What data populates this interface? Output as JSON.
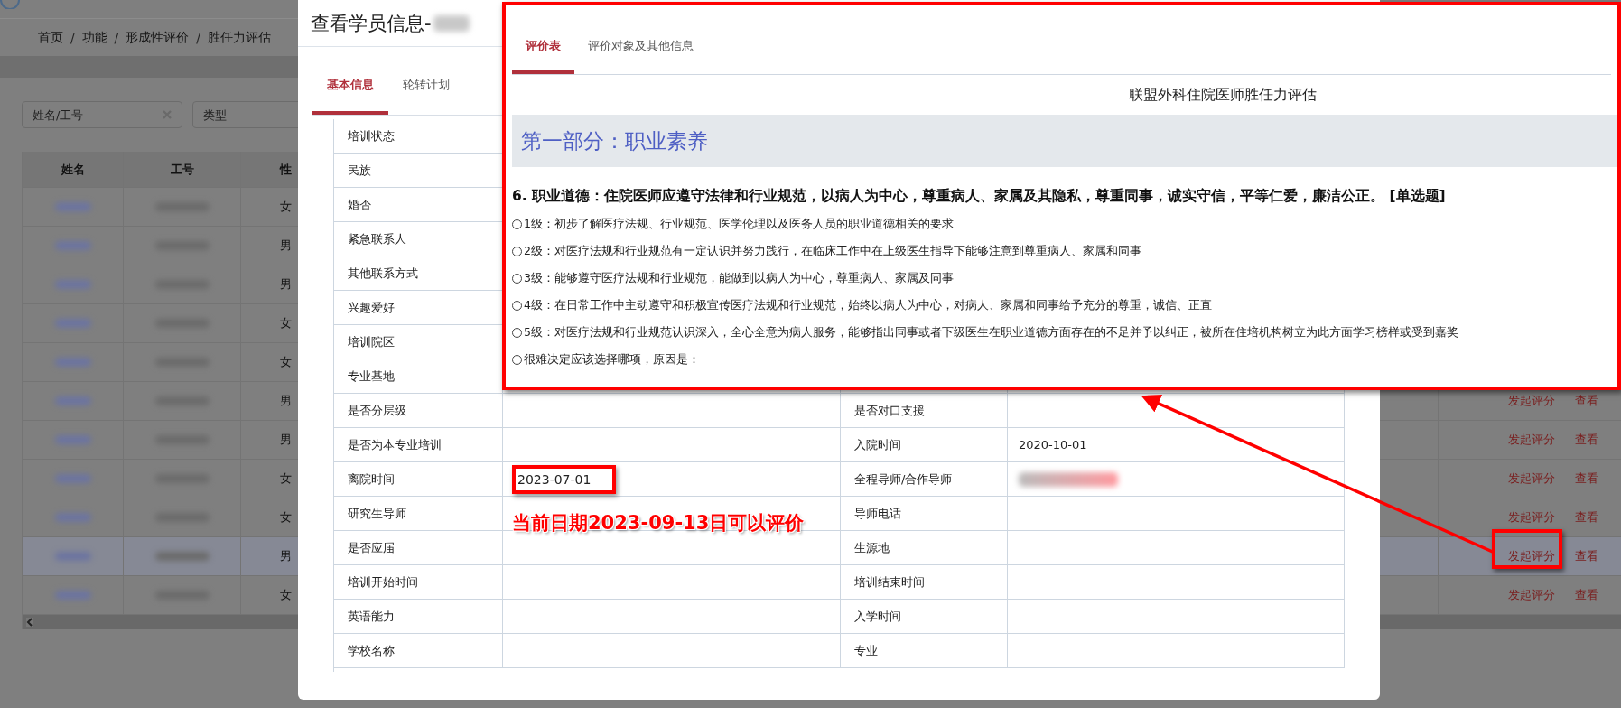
{
  "breadcrumb": {
    "separator": "/",
    "items": [
      "首页",
      "功能",
      "形成性评价",
      "胜任力评估"
    ]
  },
  "filters": [
    {
      "placeholder": "姓名/工号",
      "clearable": true
    },
    {
      "placeholder": "类型",
      "clearable": false
    }
  ],
  "background_table": {
    "columns": [
      "姓名",
      "工号",
      "性"
    ],
    "rows": [
      {
        "gender": "女",
        "selected": false
      },
      {
        "gender": "男",
        "selected": false
      },
      {
        "gender": "男",
        "selected": false
      },
      {
        "gender": "女",
        "selected": false
      },
      {
        "gender": "女",
        "selected": false
      },
      {
        "gender": "男",
        "selected": false,
        "actions": [
          "发起评分",
          "查看"
        ]
      },
      {
        "gender": "男",
        "selected": false,
        "actions": [
          "发起评分",
          "查看"
        ]
      },
      {
        "gender": "女",
        "selected": false,
        "actions": [
          "发起评分",
          "查看"
        ]
      },
      {
        "gender": "女",
        "selected": false,
        "actions": [
          "发起评分",
          "查看"
        ]
      },
      {
        "gender": "男",
        "selected": true,
        "actions": [
          "发起评分",
          "查看"
        ]
      },
      {
        "gender": "女",
        "selected": false,
        "actions": [
          "发起评分",
          "查看"
        ]
      }
    ]
  },
  "modal": {
    "title": "查看学员信息-",
    "name_blurred": true,
    "tabs": [
      {
        "label": "基本信息",
        "selected": true
      },
      {
        "label": "轮转计划",
        "selected": false
      }
    ],
    "info_rows": [
      {
        "label": "培训状态"
      },
      {
        "label": "民族"
      },
      {
        "label": "婚否"
      },
      {
        "label": "紧急联系人"
      },
      {
        "label": "其他联系方式"
      },
      {
        "label": "兴趣爱好"
      },
      {
        "label": "培训院区"
      },
      {
        "label": "专业基地"
      },
      {
        "label": "是否分层级",
        "label2": "是否对口支援"
      },
      {
        "label": "是否为本专业培训",
        "label2": "入院时间",
        "value2": "2020-10-01"
      },
      {
        "label": "离院时间",
        "value": "2023-07-01",
        "value_highlighted": true,
        "label2": "全程导师/合作导师",
        "value2_blurred": true
      },
      {
        "label": "研究生导师",
        "label2": "导师电话"
      },
      {
        "label": "是否应届",
        "label2": "生源地"
      },
      {
        "label": "培训开始时间",
        "label2": "培训结束时间"
      },
      {
        "label": "英语能力",
        "label2": "入学时间"
      },
      {
        "label": "学校名称",
        "label2": "专业"
      }
    ]
  },
  "callout": {
    "tabs": [
      {
        "label": "评价表",
        "selected": true
      },
      {
        "label": "评价对象及其他信息",
        "selected": false
      }
    ],
    "form_title": "联盟外科住院医师胜任力评估",
    "section": "第一部分：职业素养",
    "question": "6. 职业道德：住院医师应遵守法律和行业规范，以病人为中心，尊重病人、家属及其隐私，尊重同事，诚实守信，平等仁爱，廉洁公正。 [单选题]",
    "options": [
      {
        "label": "1级：初步了解医疗法规、行业规范、医学伦理以及医务人员的职业道德相关的要求",
        "selected": false
      },
      {
        "label": "2级：对医疗法规和行业规范有一定认识并努力践行，在临床工作中在上级医生指导下能够注意到尊重病人、家属和同事",
        "selected": false
      },
      {
        "label": "3级：能够遵守医疗法规和行业规范，能做到以病人为中心，尊重病人、家属及同事",
        "selected": false
      },
      {
        "label": "4级：在日常工作中主动遵守和积极宣传医疗法规和行业规范，始终以病人为中心，对病人、家属和同事给予充分的尊重，诚信、正直",
        "selected": false
      },
      {
        "label": "5级：对医疗法规和行业规范认识深入，全心全意为病人服务，能够指出同事或者下级医生在职业道德方面存在的不足并予以纠正，被所在住培机构树立为此方面学习榜样或受到嘉奖",
        "selected": false
      },
      {
        "label": "很难决定应该选择哪项，原因是：",
        "selected": false
      }
    ]
  },
  "annotation": {
    "note": "当前日期2023-09-13日可以评价"
  }
}
